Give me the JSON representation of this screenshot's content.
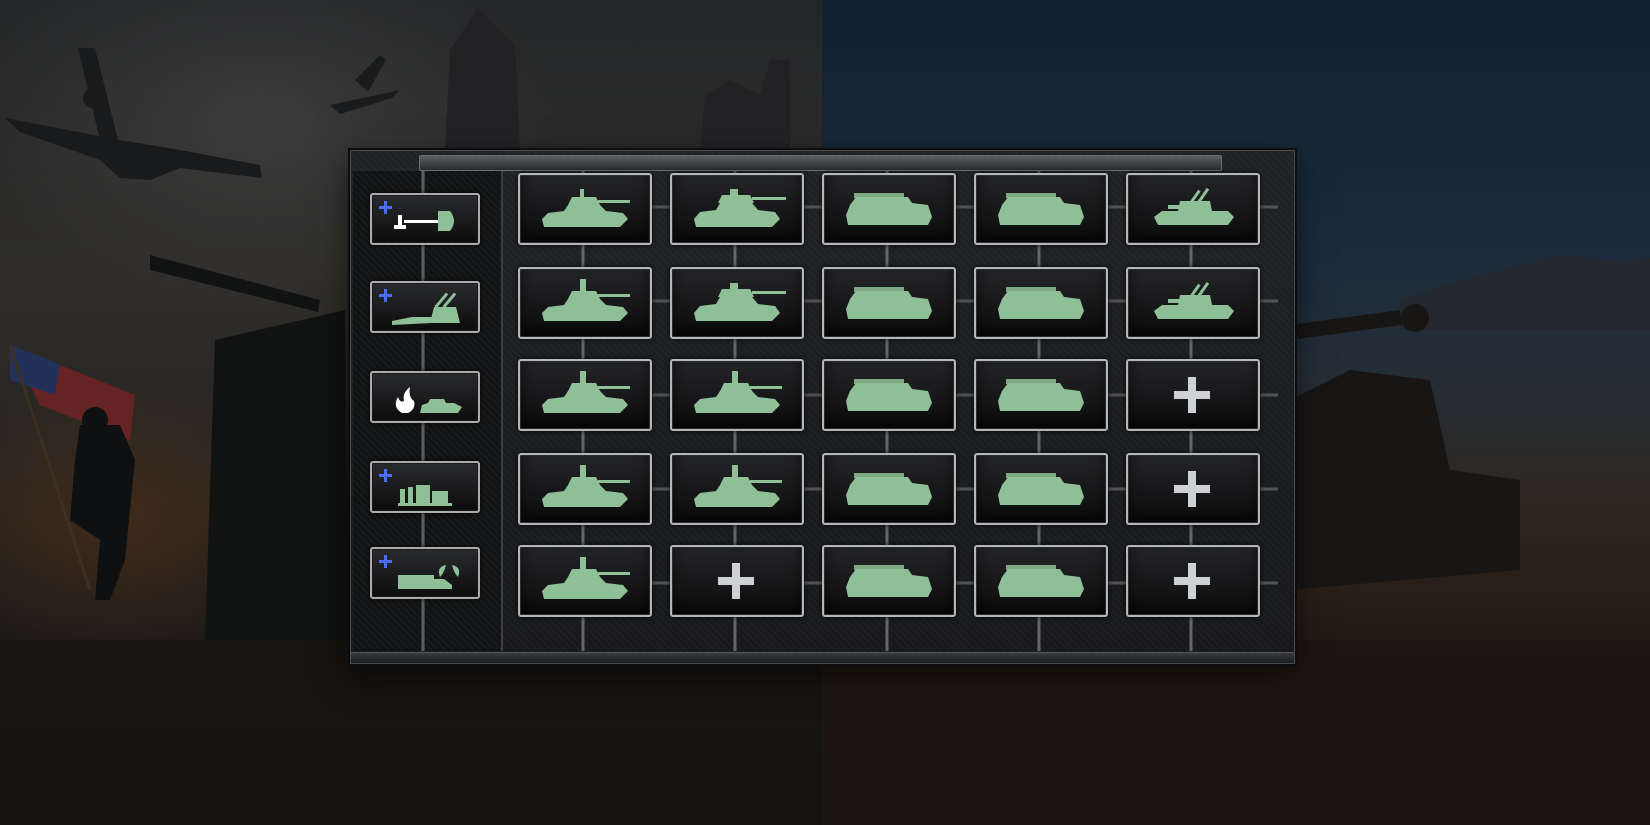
{
  "screen": "unit-loadout-grid",
  "colors": {
    "unit_fill": "#8fbf96",
    "add_icon": "#cfd2d4",
    "plus_badge": "#4d6cff",
    "frame": "#b4b6b9"
  },
  "sidebar": {
    "categories": [
      {
        "icon": "shovel-icon",
        "badge": "plus-badge-icon"
      },
      {
        "icon": "anti-air-gun-icon",
        "badge": "plus-badge-icon"
      },
      {
        "icon": "flame-tank-icon",
        "badge": null
      },
      {
        "icon": "supply-crates-icon",
        "badge": "plus-badge-icon"
      },
      {
        "icon": "supply-truck-icon",
        "badge": "plus-badge-icon"
      }
    ]
  },
  "grid": {
    "rows": [
      [
        "medium-tank-icon",
        "heavy-tank-icon",
        "halftrack-icon",
        "halftrack-icon",
        "aa-vehicle-icon"
      ],
      [
        "command-tank-icon",
        "heavy-tank-icon",
        "halftrack-icon",
        "halftrack-icon",
        "aa-vehicle-icon"
      ],
      [
        "command-tank-icon",
        "command-tank-icon",
        "halftrack-icon",
        "halftrack-icon",
        "add-slot-icon"
      ],
      [
        "command-tank-icon",
        "command-tank-icon",
        "halftrack-icon",
        "halftrack-icon",
        "add-slot-icon"
      ],
      [
        "command-tank-icon",
        "add-slot-icon",
        "halftrack-icon",
        "halftrack-icon",
        "add-slot-icon"
      ]
    ]
  }
}
